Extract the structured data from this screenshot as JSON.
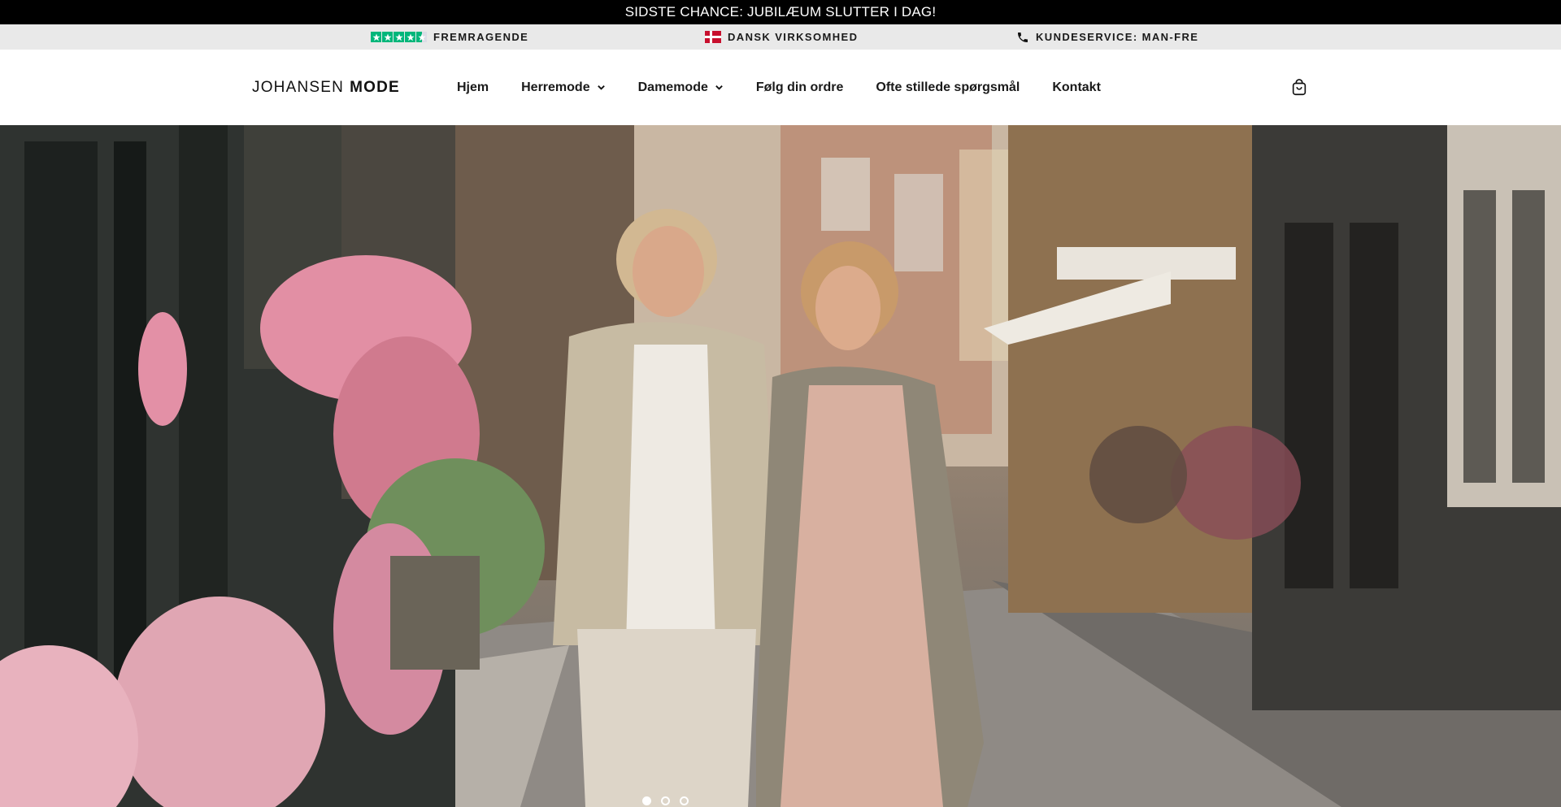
{
  "announcement": "SIDSTE CHANCE: JUBILÆUM SLUTTER I DAG!",
  "trustbar": {
    "rating_label": "FREMRAGENDE",
    "company_label": "DANSK VIRKSOMHED",
    "service_label": "KUNDESERVICE: MAN-FRE",
    "rating_stars": 4.5,
    "rating_color": "#00b67a"
  },
  "header": {
    "logo_light": "JOHANSEN",
    "logo_bold": "MODE",
    "nav": [
      {
        "label": "Hjem",
        "dropdown": false
      },
      {
        "label": "Herremode",
        "dropdown": true
      },
      {
        "label": "Damemode",
        "dropdown": true
      },
      {
        "label": "Følg din ordre",
        "dropdown": false
      },
      {
        "label": "Ofte stillede spørgsmål",
        "dropdown": false
      },
      {
        "label": "Kontakt",
        "dropdown": false
      }
    ],
    "cart_icon": "shopping-bag-icon"
  },
  "hero": {
    "image": "couple-walking-street-photo",
    "slides": 3,
    "active_slide": 1
  },
  "colors": {
    "announcement_bg": "#000000",
    "trustbar_bg": "#e9e9e9",
    "accent_flag": "#c8102e"
  }
}
